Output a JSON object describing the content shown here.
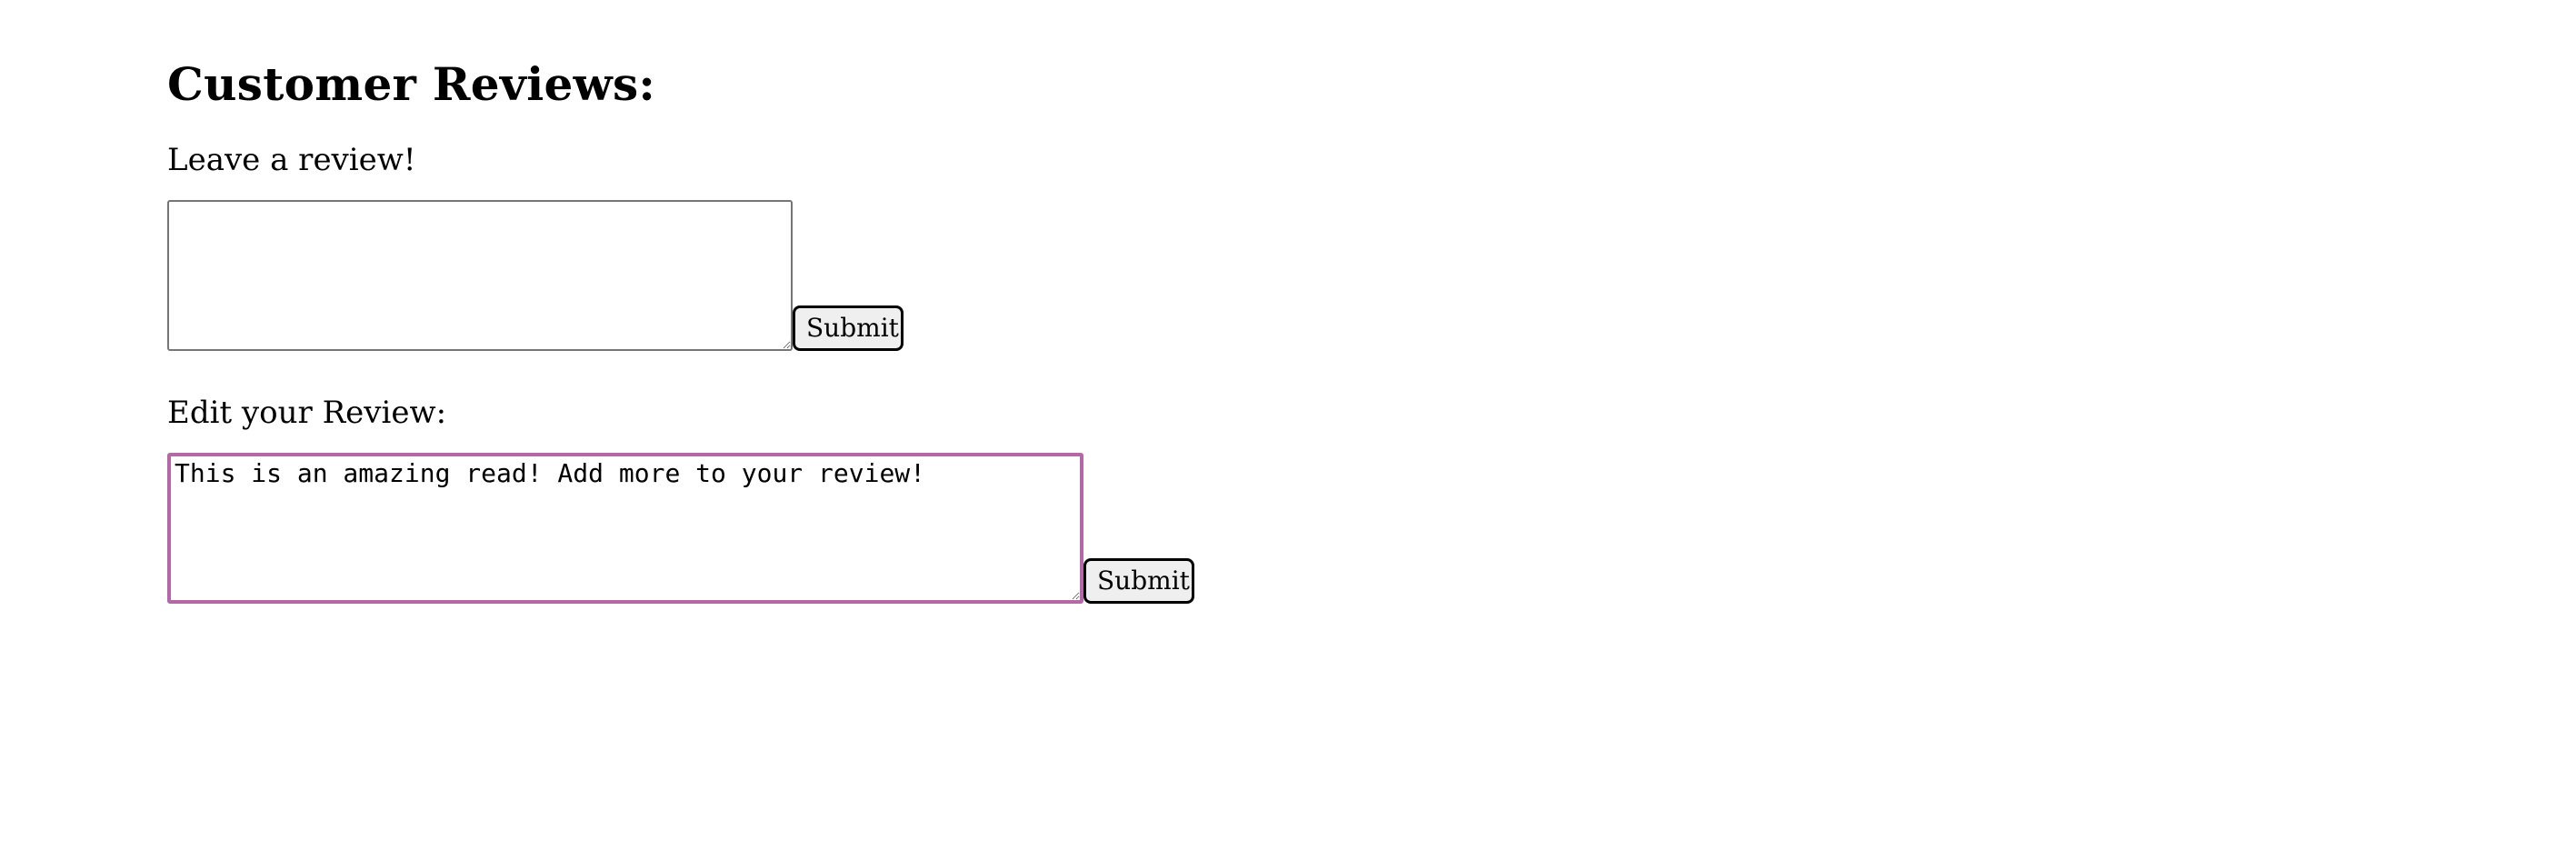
{
  "page": {
    "heading": "Customer Reviews:"
  },
  "new_review": {
    "label": "Leave a review!",
    "value": "",
    "placeholder": "",
    "submit_label": "Submit"
  },
  "edit_review": {
    "label": "Edit your Review:",
    "value": "This is an amazing read! Add more to your review! ",
    "submit_label": "Submit",
    "focus_color": "#b468a8"
  }
}
